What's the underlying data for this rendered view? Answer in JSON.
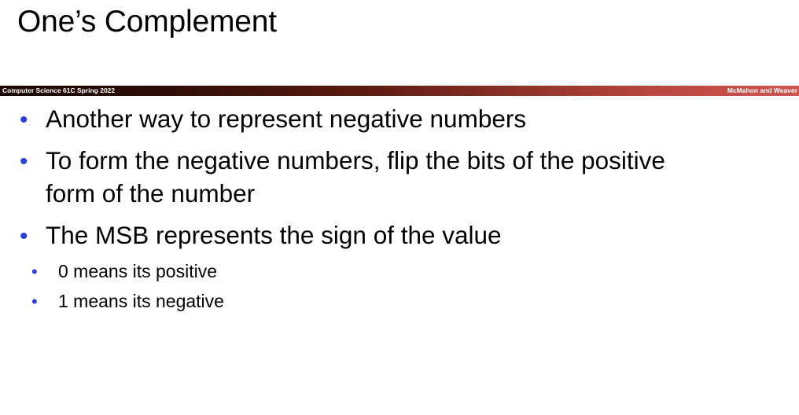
{
  "slide": {
    "title": "One’s Complement"
  },
  "banner": {
    "left_text": "Computer Science 61C Spring 2022",
    "right_text": "McMahon and Weaver"
  },
  "bullets": [
    {
      "marker": "•",
      "level": 1,
      "lines": [
        "Another way to represent negative numbers"
      ]
    },
    {
      "marker": "•",
      "level": 1,
      "lines": [
        "To form the negative numbers, flip the bits of the positive",
        "form of the number"
      ]
    },
    {
      "marker": "•",
      "level": 1,
      "lines": [
        "The MSB represents the sign of the value"
      ]
    },
    {
      "marker": "•",
      "level": 2,
      "lines": [
        "0 means its positive"
      ]
    },
    {
      "marker": "•",
      "level": 2,
      "lines": [
        "1 means its negative"
      ]
    }
  ],
  "colors": {
    "bullet_marker": "#2a3fd6",
    "banner_start": "#1a0703",
    "banner_end": "#d0564f"
  }
}
